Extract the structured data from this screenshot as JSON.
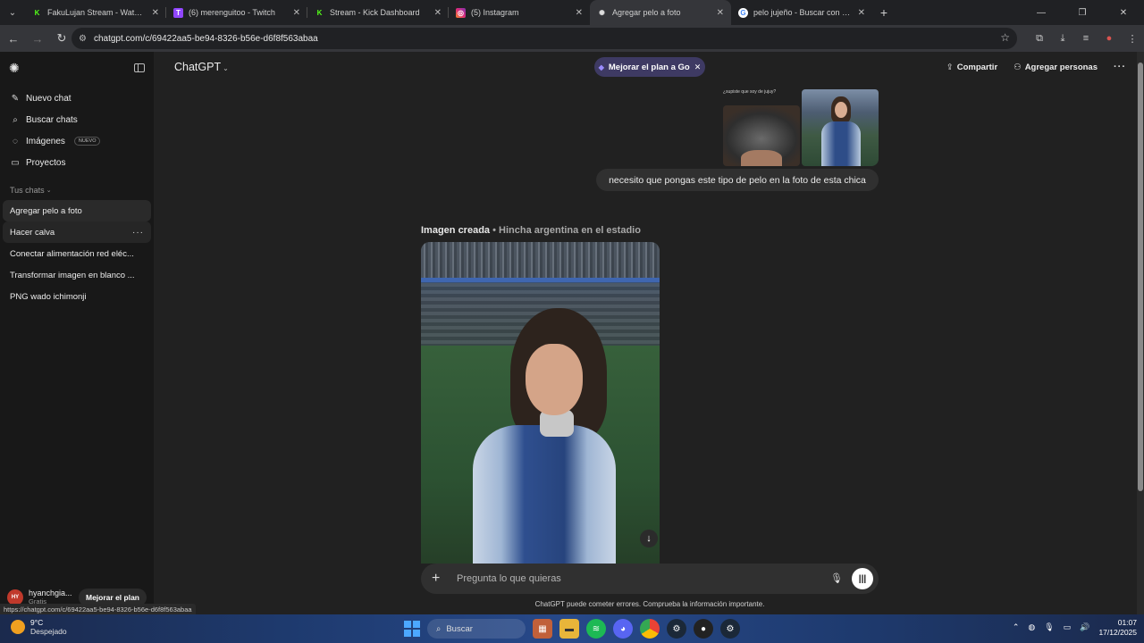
{
  "browser": {
    "tabs": [
      {
        "title": "FakuLujan Stream - Watch Live",
        "favicon_color": "#53fc18",
        "favicon": "K"
      },
      {
        "title": "(6) merenguitoo - Twitch",
        "favicon_color": "#9146ff",
        "favicon": "T"
      },
      {
        "title": "Stream - Kick Dashboard",
        "favicon_color": "#53fc18",
        "favicon": "K"
      },
      {
        "title": "(5) Instagram",
        "favicon_color": "#e1306c",
        "favicon": "◎"
      },
      {
        "title": "Agregar pelo a foto",
        "favicon_color": "#dddddd",
        "favicon": "✺",
        "active": true
      },
      {
        "title": "pelo jujeño - Buscar con Googl",
        "favicon_color": "#ffffff",
        "favicon": "G"
      }
    ],
    "url": "chatgpt.com/c/69422aa5-be94-8326-b56e-d6f8f563abaa",
    "status_url": "https://chatgpt.com/c/69422aa5-be94-8326-b56e-d6f8f563abaa"
  },
  "sidebar": {
    "nav": [
      {
        "label": "Nuevo chat",
        "icon": "edit-icon"
      },
      {
        "label": "Buscar chats",
        "icon": "search-icon"
      },
      {
        "label": "Imágenes",
        "icon": "images-icon",
        "badge": "NUEVO"
      },
      {
        "label": "Proyectos",
        "icon": "folder-icon"
      }
    ],
    "section_label": "Tus chats",
    "chats": [
      {
        "label": "Agregar pelo a foto",
        "active": true
      },
      {
        "label": "Hacer calva",
        "hover": true
      },
      {
        "label": "Conectar alimentación red eléc..."
      },
      {
        "label": "Transformar imagen en blanco ..."
      },
      {
        "label": "PNG wado ichimonji"
      }
    ],
    "user": {
      "initials": "HY",
      "name": "hyanchgia...",
      "plan": "Gratis"
    },
    "upgrade_label": "Mejorar el plan"
  },
  "header": {
    "model": "ChatGPT",
    "go_pill": "Mejorar el plan a Go",
    "share": "Compartir",
    "add_people": "Agregar personas"
  },
  "conversation": {
    "user_image_caption": "¿supiste que soy de jujuy?",
    "user_message": "necesito que pongas este tipo de pelo en la foto de esta chica",
    "created_label": "Imagen creada",
    "created_title": "• Hincha argentina en el estadio"
  },
  "composer": {
    "placeholder": "Pregunta lo que quieras",
    "disclaimer": "ChatGPT puede cometer errores. Comprueba la información importante."
  },
  "taskbar": {
    "weather_temp": "9°C",
    "weather_desc": "Despejado",
    "search": "Buscar",
    "time": "01:07",
    "date": "17/12/2025"
  }
}
